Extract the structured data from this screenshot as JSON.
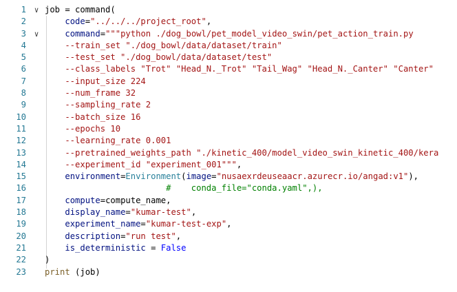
{
  "editor": {
    "lines": [
      {
        "n": "1",
        "fold": "∨",
        "segments": [
          {
            "t": "job = command(",
            "c": "plain"
          }
        ]
      },
      {
        "n": "2",
        "fold": "",
        "segments": [
          {
            "t": "    ",
            "c": "plain"
          },
          {
            "t": "code",
            "c": "param"
          },
          {
            "t": "=",
            "c": "plain"
          },
          {
            "t": "\"../../../project_root\"",
            "c": "str"
          },
          {
            "t": ",",
            "c": "plain"
          }
        ]
      },
      {
        "n": "3",
        "fold": "∨",
        "segments": [
          {
            "t": "    ",
            "c": "plain"
          },
          {
            "t": "command",
            "c": "param"
          },
          {
            "t": "=",
            "c": "plain"
          },
          {
            "t": "\"\"\"python ./dog_bowl/pet_model_video_swin/pet_action_train.py",
            "c": "str"
          }
        ]
      },
      {
        "n": "4",
        "fold": "",
        "segments": [
          {
            "t": "    --train_set \"./dog_bowl/data/dataset/train\"",
            "c": "str"
          }
        ]
      },
      {
        "n": "5",
        "fold": "",
        "segments": [
          {
            "t": "    --test_set \"./dog_bowl/data/dataset/test\"",
            "c": "str"
          }
        ]
      },
      {
        "n": "6",
        "fold": "",
        "segments": [
          {
            "t": "    --class_labels \"Trot\" \"Head_N._Trot\" \"Tail_Wag\" \"Head_N._Canter\" \"Canter\"",
            "c": "str"
          }
        ]
      },
      {
        "n": "7",
        "fold": "",
        "segments": [
          {
            "t": "    --input_size 224",
            "c": "str"
          }
        ]
      },
      {
        "n": "8",
        "fold": "",
        "segments": [
          {
            "t": "    --num_frame 32",
            "c": "str"
          }
        ]
      },
      {
        "n": "9",
        "fold": "",
        "segments": [
          {
            "t": "    --sampling_rate 2",
            "c": "str"
          }
        ]
      },
      {
        "n": "10",
        "fold": "",
        "segments": [
          {
            "t": "    --batch_size 16",
            "c": "str"
          }
        ]
      },
      {
        "n": "11",
        "fold": "",
        "segments": [
          {
            "t": "    --epochs 10",
            "c": "str"
          }
        ]
      },
      {
        "n": "12",
        "fold": "",
        "segments": [
          {
            "t": "    --learning_rate 0.001",
            "c": "str"
          }
        ]
      },
      {
        "n": "13",
        "fold": "",
        "segments": [
          {
            "t": "    --pretrained_weights_path \"./kinetic_400/model_video_swin_kinetic_400/kera",
            "c": "str"
          }
        ]
      },
      {
        "n": "14",
        "fold": "",
        "segments": [
          {
            "t": "    --experiment_id \"experiment_001\"\"\"",
            "c": "str"
          },
          {
            "t": ",",
            "c": "plain"
          }
        ]
      },
      {
        "n": "15",
        "fold": "",
        "segments": [
          {
            "t": "    ",
            "c": "plain"
          },
          {
            "t": "environment",
            "c": "param"
          },
          {
            "t": "=",
            "c": "plain"
          },
          {
            "t": "Environment",
            "c": "cls"
          },
          {
            "t": "(",
            "c": "plain"
          },
          {
            "t": "image",
            "c": "param"
          },
          {
            "t": "=",
            "c": "plain"
          },
          {
            "t": "\"nusaexrdeuseaacr.azurecr.io/angad:v1\"",
            "c": "str"
          },
          {
            "t": "),",
            "c": "plain"
          }
        ]
      },
      {
        "n": "16",
        "fold": "",
        "segments": [
          {
            "t": "                        #    conda_file=\"conda.yaml\",),",
            "c": "cmt"
          }
        ]
      },
      {
        "n": "17",
        "fold": "",
        "segments": [
          {
            "t": "    ",
            "c": "plain"
          },
          {
            "t": "compute",
            "c": "param"
          },
          {
            "t": "=compute_name,",
            "c": "plain"
          }
        ]
      },
      {
        "n": "18",
        "fold": "",
        "segments": [
          {
            "t": "    ",
            "c": "plain"
          },
          {
            "t": "display_name",
            "c": "param"
          },
          {
            "t": "=",
            "c": "plain"
          },
          {
            "t": "\"kumar-test\"",
            "c": "str"
          },
          {
            "t": ",",
            "c": "plain"
          }
        ]
      },
      {
        "n": "19",
        "fold": "",
        "segments": [
          {
            "t": "    ",
            "c": "plain"
          },
          {
            "t": "experiment_name",
            "c": "param"
          },
          {
            "t": "=",
            "c": "plain"
          },
          {
            "t": "\"kumar-test-exp\"",
            "c": "str"
          },
          {
            "t": ",",
            "c": "plain"
          }
        ]
      },
      {
        "n": "20",
        "fold": "",
        "segments": [
          {
            "t": "    ",
            "c": "plain"
          },
          {
            "t": "description",
            "c": "param"
          },
          {
            "t": "=",
            "c": "plain"
          },
          {
            "t": "\"run test\"",
            "c": "str"
          },
          {
            "t": ",",
            "c": "plain"
          }
        ]
      },
      {
        "n": "21",
        "fold": "",
        "segments": [
          {
            "t": "    ",
            "c": "plain"
          },
          {
            "t": "is_deterministic",
            "c": "param"
          },
          {
            "t": " = ",
            "c": "plain"
          },
          {
            "t": "False",
            "c": "const"
          }
        ]
      },
      {
        "n": "22",
        "fold": "",
        "segments": [
          {
            "t": ")",
            "c": "plain"
          }
        ]
      },
      {
        "n": "23",
        "fold": "",
        "segments": [
          {
            "t": "print",
            "c": "fn"
          },
          {
            "t": " (job)",
            "c": "plain"
          }
        ]
      }
    ]
  },
  "colors": {
    "line_number": "#237893",
    "string": "#a31515",
    "parameter": "#001080",
    "function": "#795e26",
    "class": "#267f99",
    "comment": "#008000",
    "constant": "#0000ff"
  }
}
